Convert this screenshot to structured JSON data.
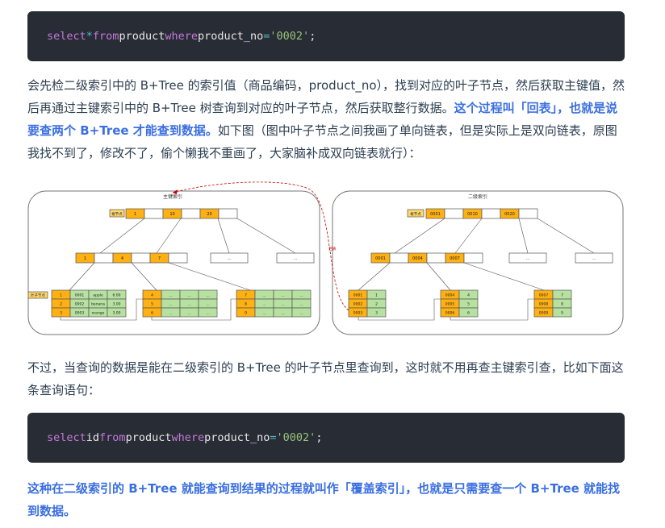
{
  "code1": {
    "t1": "select",
    "t2": "*",
    "t3": "from",
    "t4": "product",
    "t5": "where",
    "t6": "product_no",
    "t7": "=",
    "t8": "'0002'",
    "t9": ";"
  },
  "para1": {
    "text": "会先检二级索引中的 B+Tree 的索引值（商品编码，product_no），找到对应的叶子节点，然后获取主键值，然后再通过主键索引中的 B+Tree 树查询到对应的叶子节点，然后获取整行数据。",
    "highlight": "这个过程叫「回表」，也就是说要查两个 B+Tree 才能查到数据。",
    "tail": "如下图（图中叶子节点之间我画了单向链表，但是实际上是双向链表，原图我找不到了，修改不了，偷个懒我不重画了，大家脑补成双向链表就行）："
  },
  "diagram": {
    "left_title": "主键索引",
    "right_title": "二级索引",
    "left_root_tag": "根节点",
    "right_root_tag": "根节点",
    "left_leaf_tag": "叶子节点",
    "back_label": "回表",
    "left_root": [
      "1",
      "10",
      "20"
    ],
    "left_mid": [
      "1",
      "4",
      "7"
    ],
    "ellipsis": "...",
    "left_leaf1": [
      [
        "1",
        "0001",
        "apple",
        "6.00"
      ],
      [
        "2",
        "0002",
        "banana",
        "3.00"
      ],
      [
        "3",
        "0003",
        "orange",
        "3.00"
      ]
    ],
    "left_leaf2": [
      [
        "4",
        "...",
        "...",
        "..."
      ],
      [
        "5",
        "...",
        "...",
        "..."
      ],
      [
        "6",
        "...",
        "...",
        "..."
      ]
    ],
    "left_leaf3": [
      [
        "7",
        "...",
        "...",
        "..."
      ],
      [
        "8",
        "...",
        "...",
        "..."
      ],
      [
        "9",
        "...",
        "...",
        "..."
      ]
    ],
    "right_root": [
      "0001",
      "0010",
      "0020"
    ],
    "right_mid": [
      "0001",
      "0004",
      "0007"
    ],
    "right_leaf1": [
      [
        "0001",
        "1"
      ],
      [
        "0002",
        "2"
      ],
      [
        "0003",
        "3"
      ]
    ],
    "right_leaf2": [
      [
        "0004",
        "4"
      ],
      [
        "0005",
        "5"
      ],
      [
        "0006",
        "6"
      ]
    ],
    "right_leaf3": [
      [
        "0007",
        "7"
      ],
      [
        "0008",
        "8"
      ],
      [
        "0009",
        "9"
      ]
    ],
    "colors": {
      "orange": "#ffb012",
      "green": "#b7e1a1",
      "border": "#555555",
      "red": "#cc0000"
    }
  },
  "para2": {
    "text": "不过，当查询的数据是能在二级索引的 B+Tree 的叶子节点里查询到，这时就不用再查主键索引查，比如下面这条查询语句："
  },
  "code2": {
    "t1": "select",
    "t2": "id",
    "t3": "from",
    "t4": "product",
    "t5": "where",
    "t6": "product_no",
    "t7": "=",
    "t8": "'0002'",
    "t9": ";"
  },
  "para3": {
    "text": "这种在二级索引的 B+Tree 就能查询到结果的过程就叫作「覆盖索引」，也就是只需要查一个 B+Tree 就能找到数据。"
  }
}
